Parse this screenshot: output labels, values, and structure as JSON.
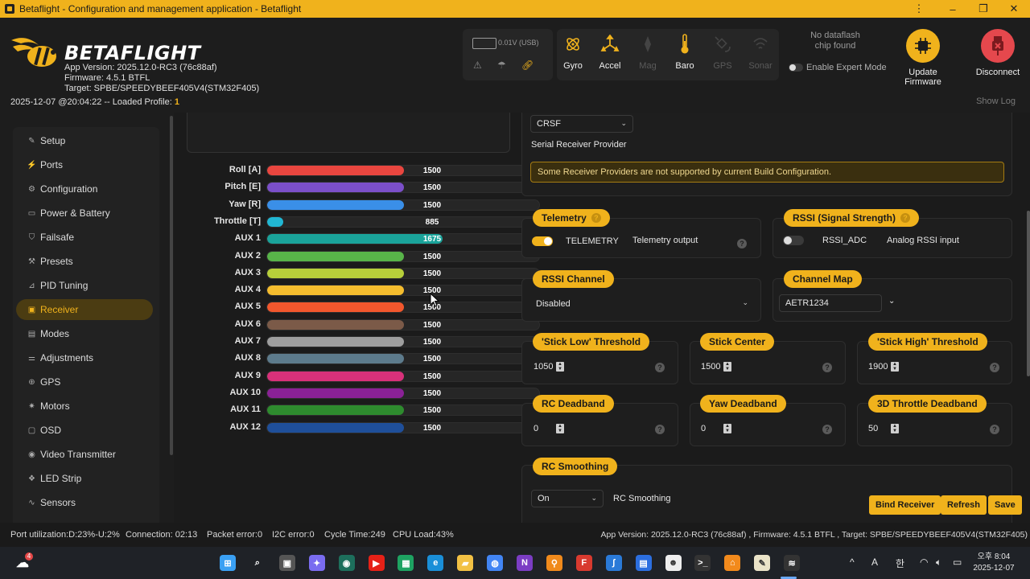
{
  "window": {
    "title": "Betaflight - Configuration and management application - Betaflight",
    "controls": [
      "⋮",
      "–",
      "❐",
      "✕"
    ]
  },
  "header": {
    "brand": "BETAFLIGHT",
    "app_version": "App Version: 2025.12.0-RC3 (76c88af)",
    "firmware": "Firmware: 4.5.1 BTFL",
    "target": "Target: SPBE/SPEEDYBEEF405V4(STM32F405)",
    "loaded_prefix": "2025-12-07 @20:04:22 -- Loaded Profile: ",
    "loaded_profile": "1",
    "battery_label": "0.01V (USB)",
    "sensors": [
      {
        "label": "Gyro",
        "on": true
      },
      {
        "label": "Accel",
        "on": true
      },
      {
        "label": "Mag",
        "on": false
      },
      {
        "label": "Baro",
        "on": true
      },
      {
        "label": "GPS",
        "on": false
      },
      {
        "label": "Sonar",
        "on": false
      }
    ],
    "dataflash_line1": "No dataflash",
    "dataflash_line2": "chip found",
    "expert_mode": "Enable Expert Mode",
    "update_firmware": "Update Firmware",
    "disconnect": "Disconnect",
    "show_log": "Show Log",
    "accent": "#f0b21c",
    "disconnect_color": "#e5484d"
  },
  "sidebar": {
    "items": [
      {
        "label": "Setup",
        "icon": "✎"
      },
      {
        "label": "Ports",
        "icon": "⚡"
      },
      {
        "label": "Configuration",
        "icon": "⚙"
      },
      {
        "label": "Power & Battery",
        "icon": "▭"
      },
      {
        "label": "Failsafe",
        "icon": "⛉"
      },
      {
        "label": "Presets",
        "icon": "⚒"
      },
      {
        "label": "PID Tuning",
        "icon": "⊿"
      },
      {
        "label": "Receiver",
        "icon": "▣",
        "active": true
      },
      {
        "label": "Modes",
        "icon": "▤"
      },
      {
        "label": "Adjustments",
        "icon": "⚌"
      },
      {
        "label": "GPS",
        "icon": "⊕"
      },
      {
        "label": "Motors",
        "icon": "✷"
      },
      {
        "label": "OSD",
        "icon": "▢"
      },
      {
        "label": "Video Transmitter",
        "icon": "◉"
      },
      {
        "label": "LED Strip",
        "icon": "❖"
      },
      {
        "label": "Sensors",
        "icon": "∿"
      }
    ]
  },
  "channels": [
    {
      "label": "Roll [A]",
      "value": 1500,
      "color": "#e9463f"
    },
    {
      "label": "Pitch [E]",
      "value": 1500,
      "color": "#7b4fc9"
    },
    {
      "label": "Yaw [R]",
      "value": 1500,
      "color": "#3a8fe8"
    },
    {
      "label": "Throttle [T]",
      "value": 885,
      "color": "#21b7d3"
    },
    {
      "label": "AUX 1",
      "value": 1675,
      "color": "#1aa39a"
    },
    {
      "label": "AUX 2",
      "value": 1500,
      "color": "#58b449"
    },
    {
      "label": "AUX 3",
      "value": 1500,
      "color": "#b7cf3a"
    },
    {
      "label": "AUX 4",
      "value": 1500,
      "color": "#f5bd2e"
    },
    {
      "label": "AUX 5",
      "value": 1500,
      "color": "#f2572d"
    },
    {
      "label": "AUX 6",
      "value": 1500,
      "color": "#7b5a48"
    },
    {
      "label": "AUX 7",
      "value": 1500,
      "color": "#9e9e9e"
    },
    {
      "label": "AUX 8",
      "value": 1500,
      "color": "#5d7b8c"
    },
    {
      "label": "AUX 9",
      "value": 1500,
      "color": "#d8317a"
    },
    {
      "label": "AUX 10",
      "value": 1500,
      "color": "#8a2196"
    },
    {
      "label": "AUX 11",
      "value": 1500,
      "color": "#2e8b2e"
    },
    {
      "label": "AUX 12",
      "value": 1500,
      "color": "#1f4f9a"
    }
  ],
  "receiver": {
    "provider_value": "CRSF",
    "provider_label": "Serial Receiver Provider",
    "warning": "Some Receiver Providers are not supported by current Build Configuration.",
    "telemetry": {
      "title": "Telemetry",
      "toggle_label": "TELEMETRY",
      "description": "Telemetry output",
      "enabled": true
    },
    "rssi": {
      "title": "RSSI (Signal Strength)",
      "toggle_label": "RSSI_ADC",
      "description": "Analog RSSI input",
      "enabled": false
    },
    "rssi_channel": {
      "title": "RSSI Channel",
      "value": "Disabled"
    },
    "channel_map": {
      "title": "Channel Map",
      "value": "AETR1234"
    },
    "stick_low": {
      "title": "'Stick Low' Threshold",
      "value": "1050"
    },
    "stick_center": {
      "title": "Stick Center",
      "value": "1500"
    },
    "stick_high": {
      "title": "'Stick High' Threshold",
      "value": "1900"
    },
    "rc_deadband": {
      "title": "RC Deadband",
      "value": "0"
    },
    "yaw_deadband": {
      "title": "Yaw Deadband",
      "value": "0"
    },
    "throttle_deadband": {
      "title": "3D Throttle Deadband",
      "value": "50"
    },
    "rc_smoothing": {
      "title": "RC Smoothing",
      "value": "On",
      "label": "RC Smoothing"
    }
  },
  "actions": {
    "bind": "Bind Receiver",
    "refresh": "Refresh",
    "save": "Save"
  },
  "statusbar": {
    "port_util": "Port utilization:D:23%-U:2%",
    "connection": "Connection: 02:13",
    "packet_error": "Packet error:0",
    "i2c_error": "I2C error:0",
    "cycle_time": "Cycle Time:249",
    "cpu_load": "CPU Load:43%",
    "version": "App Version: 2025.12.0-RC3 (76c88af) , Firmware: 4.5.1 BTFL , Target: SPBE/SPEEDYBEEF405V4(STM32F405)"
  },
  "taskbar": {
    "weather_badge": "4",
    "apps": [
      {
        "name": "start-icon",
        "color": "#3aa0f3",
        "glyph": "⊞"
      },
      {
        "name": "search-icon",
        "color": "transparent",
        "glyph": "⌕"
      },
      {
        "name": "task-view-icon",
        "color": "#555",
        "glyph": "▣"
      },
      {
        "name": "copilot-icon",
        "color": "#7a6cf0",
        "glyph": "✦"
      },
      {
        "name": "app-icon",
        "color": "#1d6f5c",
        "glyph": "◉"
      },
      {
        "name": "youtube-icon",
        "color": "#e62117",
        "glyph": "▶"
      },
      {
        "name": "sheets-icon",
        "color": "#1ea362",
        "glyph": "▦"
      },
      {
        "name": "edge-icon",
        "color": "#1a8fd8",
        "glyph": "e"
      },
      {
        "name": "explorer-icon",
        "color": "#f2c144",
        "glyph": "▰"
      },
      {
        "name": "chrome-icon",
        "color": "#4285f4",
        "glyph": "◍"
      },
      {
        "name": "onenote-icon",
        "color": "#7b3dc4",
        "glyph": "N"
      },
      {
        "name": "search-app-icon",
        "color": "#f08a1c",
        "glyph": "⚲"
      },
      {
        "name": "forms-icon",
        "color": "#d83a2f",
        "glyph": "F"
      },
      {
        "name": "settings-app-icon",
        "color": "#2a7ad8",
        "glyph": "∫"
      },
      {
        "name": "docs-icon",
        "color": "#2c6fe0",
        "glyph": "▤"
      },
      {
        "name": "game-icon",
        "color": "#eee",
        "glyph": "☻"
      },
      {
        "name": "terminal-icon",
        "color": "#333",
        "glyph": ">_"
      },
      {
        "name": "orange-app-icon",
        "color": "#f28a1c",
        "glyph": "⌂"
      },
      {
        "name": "notepad-icon",
        "color": "#eae3c8",
        "glyph": "✎"
      },
      {
        "name": "betaflight-task-icon",
        "color": "#333",
        "glyph": "≋"
      }
    ],
    "tray": [
      "^",
      "A",
      "한"
    ],
    "clock_time": "오후 8:04",
    "clock_date": "2025-12-07"
  }
}
